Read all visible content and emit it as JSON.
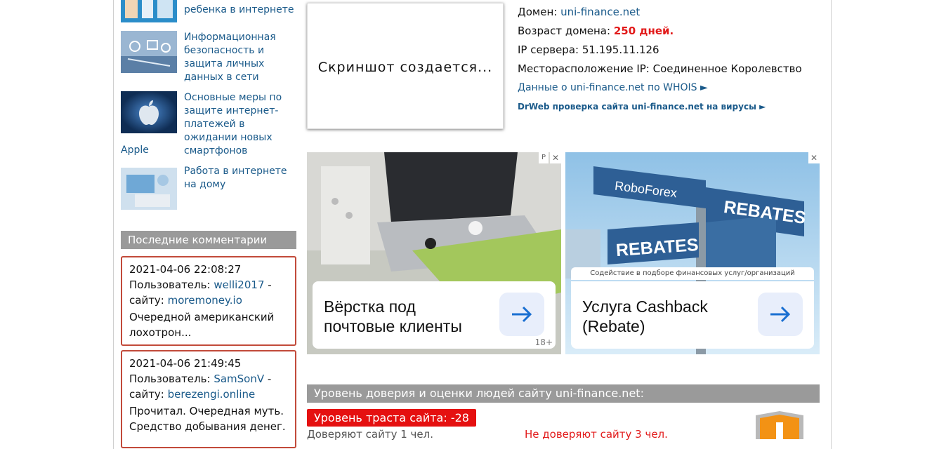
{
  "sidebar": {
    "articles": [
      {
        "title": "как обезопасить ребенка в интернете"
      },
      {
        "title": "Информационная безопасность и защита личных данных в сети"
      },
      {
        "title": "Основные меры по защите интернет-платежей в ожидании новых смартфонов",
        "tail": "Apple"
      },
      {
        "title": "Работа в интернете на дому"
      }
    ],
    "comments_header": "Последние комментарии",
    "comments": [
      {
        "date": "2021-04-06 22:08:27",
        "user_label": "Пользователь:",
        "user": "welli2017",
        "site_label": "- сайту:",
        "site": "moremoney.io",
        "text": "Очередной американский лохотрон..."
      },
      {
        "date": "2021-04-06 21:49:45",
        "user_label": "Пользователь:",
        "user": "SamSonV",
        "site_label": "- сайту:",
        "site": "berezengi.online",
        "text": "Прочитал. Очередная муть. Средство добывания денег."
      }
    ]
  },
  "screenshot": {
    "text": "Скриншот создается..."
  },
  "info": {
    "domain_label": "Домен:",
    "domain": "uni-finance.net",
    "age_label": "Возраст домена:",
    "age": "250 дней.",
    "ip_label": "IP сервера:",
    "ip": "51.195.11.126",
    "location_label": "Месторасположение IP:",
    "location": "Соединенное Королевство",
    "whois_link": "Данные о uni-finance.net по WHOIS ►",
    "drweb_link": "DrWeb проверка сайта uni-finance.net на вирусы ►"
  },
  "ads": [
    {
      "title": "Вёрстка под почтовые клиенты",
      "age": "18+",
      "p": "P",
      "close": "✕"
    },
    {
      "title": "Услуга Cashback (Rebate)",
      "caption": "Содействие в подборе финансовых услуг/организаций",
      "brand": "RoboForex",
      "sign1": "REBATES",
      "sign2": "REBATES",
      "close": "✕"
    }
  ],
  "trust": {
    "header": "Уровень доверия и оценки людей сайту uni-finance.net:",
    "badge": "Уровень траста сайта: -28",
    "like_text": "Доверяют сайту 1 чел.",
    "dislike_text": "Не доверяют сайту 3 чел."
  },
  "colors": {
    "accent_link": "#1a5a8a",
    "red": "#e21a1a",
    "gray_header": "#9a9a9a",
    "comment_border": "#c24a3a"
  }
}
